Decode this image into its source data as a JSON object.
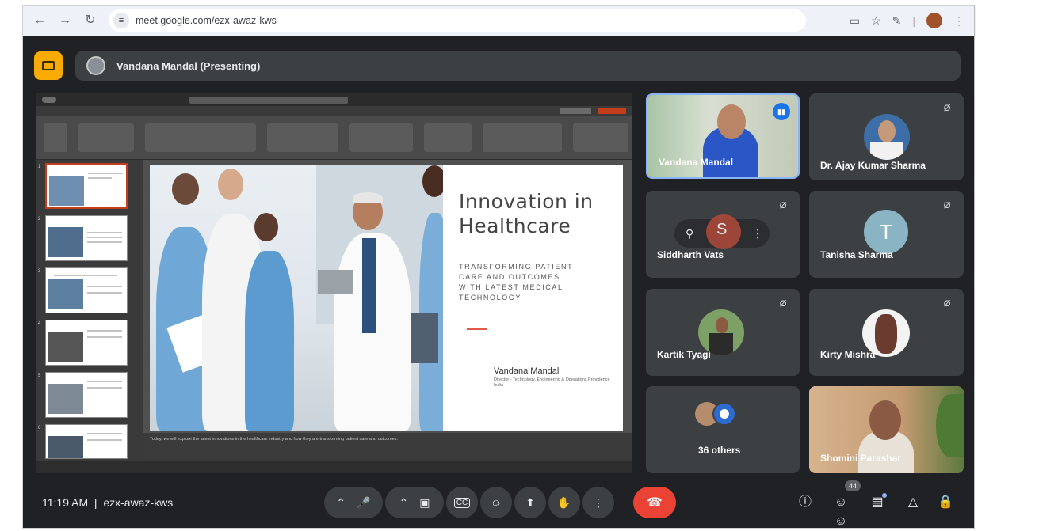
{
  "browser": {
    "url": "meet.google.com/ezx-awaz-kws",
    "back_icon": "arrow-left-icon",
    "forward_icon": "arrow-right-icon",
    "reload_icon": "reload-icon"
  },
  "meet": {
    "presenting_label": "Vandana Mandal (Presenting)",
    "time": "11:19 AM",
    "meeting_code": "ezx-awaz-kws",
    "participant_count": "44"
  },
  "slide": {
    "title_line1": "Innovation in",
    "title_line2": "Healthcare",
    "subtitle_line1": "TRANSFORMING PATIENT",
    "subtitle_line2": "CARE AND OUTCOMES",
    "subtitle_line3": "WITH LATEST MEDICAL",
    "subtitle_line4": "TECHNOLOGY",
    "presenter": "Vandana Mandal",
    "presenter_role": "Director - Technology, Engineering & Operations Providence India",
    "notes": "Today, we will explore the latest innovations in the healthcare industry and how they are transforming patient care and outcomes."
  },
  "participants": [
    {
      "name": "Vandana Mandal"
    },
    {
      "name": "Dr. Ajay Kumar Sharma"
    },
    {
      "name": "Siddharth Vats"
    },
    {
      "name": "Tanisha Sharma",
      "initial": "T"
    },
    {
      "name": "Kartik Tyagi"
    },
    {
      "name": "Kirty Mishra"
    },
    {
      "name": "36 others"
    },
    {
      "name": "Shomini Parashar"
    }
  ],
  "tile_controls": {
    "pin_icon": "pin-icon",
    "initial": "S",
    "more_icon": "more-vert-icon"
  },
  "colors": {
    "meet_bg": "#202124",
    "tile_bg": "#3c4043",
    "end_call": "#ea4335",
    "accent_yellow": "#f9ab00",
    "active_speaker": "#8ab4f8"
  }
}
